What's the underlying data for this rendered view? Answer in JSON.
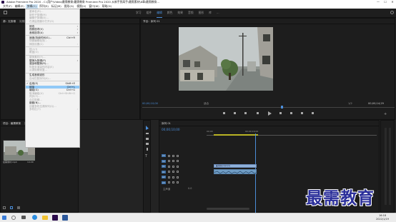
{
  "titlebar": {
    "title": "Adobe Premiere Pro 2020 - C:\\用户\\Video\\最需教育\\最需教育 Premiere Pro 2020 从新手到高手\\最需素材\\8章\\最需教育...",
    "min": "—",
    "max": "☐",
    "close": "✕"
  },
  "menubar": [
    "文件(F)",
    "编辑(E)",
    "剪辑(C)",
    "序列(S)",
    "标记(M)",
    "图形(G)",
    "视图(V)",
    "窗口(W)",
    "帮助(H)"
  ],
  "workspaces": [
    "学习",
    "组件",
    "编辑",
    "颜色",
    "效果",
    "音频",
    "图形",
    "库",
    "..."
  ],
  "active_workspace": "编辑",
  "source_tabs": [
    "源：无剪辑",
    "效果控件",
    "音频剪辑混合器：序列 01",
    "元数据"
  ],
  "program_tab": "节目：序列 01",
  "program": {
    "timecode_left": "00;00;10;00",
    "fit": "适合",
    "ratio": "1/2",
    "timecode_right": "00;00;14;29"
  },
  "menu": {
    "items": [
      {
        "label": "重命名(R)...",
        "dis": true
      },
      {
        "label": "制作子剪辑(M)",
        "dis": true
      },
      {
        "label": "编辑子剪辑(D)...",
        "dis": true
      },
      {
        "label": "在源监视器中打开(O)",
        "dis": true
      },
      {
        "label": "修改",
        "dis": false,
        "sub": true,
        "sepBefore": true
      },
      {
        "label": "视频选项(V)",
        "dis": false,
        "sub": true
      },
      {
        "label": "音频选项(A)",
        "dis": false,
        "sub": true
      },
      {
        "label": "速度/持续时间(S)...",
        "dis": false,
        "sc": "Ctrl+R",
        "sepBefore": true
      },
      {
        "label": "场景编辑检测...",
        "dis": true
      },
      {
        "label": "捕捉设置(C)",
        "dis": true,
        "sub": true
      },
      {
        "label": "插入(I)",
        "dis": true,
        "sepBefore": true
      },
      {
        "label": "覆盖(O)",
        "dis": true
      },
      {
        "label": "替换素材(F)...",
        "dis": true,
        "sepBefore": true
      },
      {
        "label": "替换为剪辑(P)",
        "dis": false,
        "sub": true
      },
      {
        "label": "渲染和替换(R)...",
        "dis": false
      },
      {
        "label": "恢复未渲染的内容(E)",
        "dis": true
      },
      {
        "label": "从源剪辑恢复...",
        "dis": true
      },
      {
        "label": "生成音频波形",
        "dis": false,
        "sepBefore": true
      },
      {
        "label": "自动匹配序列(A)...",
        "dis": true
      },
      {
        "label": "启用(E)",
        "dis": false,
        "sc": "Shift+E",
        "check": true,
        "sepBefore": true
      },
      {
        "label": "链接",
        "dis": false,
        "sc": "Ctrl+L",
        "hi": true
      },
      {
        "label": "编组(G)",
        "dis": false,
        "sc": "Ctrl+G"
      },
      {
        "label": "取消编组(U)",
        "dis": true,
        "sc": "Ctrl+Shift+G"
      },
      {
        "label": "同步(Y)...",
        "dis": true
      },
      {
        "label": "合并剪辑...",
        "dis": true
      },
      {
        "label": "嵌套(N)...",
        "dis": false
      },
      {
        "label": "创建多机位源序列(Q)...",
        "dis": true
      },
      {
        "label": "多机位(T)",
        "dis": true,
        "sub": true
      }
    ]
  },
  "project": {
    "tabs": [
      "项目：最需教育",
      "媒体浏览器",
      "库",
      "信息",
      "效果"
    ],
    "clip_name": "最需素材.mp4",
    "clip_duration": "14:29"
  },
  "timeline": {
    "tab": "序列 01",
    "timecode": "00;00;10;00",
    "ruler": [
      "00;00",
      "00;00;16;00"
    ],
    "tracks_v": [
      "V3",
      "V2",
      "V1"
    ],
    "tracks_a": [
      "A1",
      "A2",
      "A3"
    ],
    "master": "主声道",
    "master_val": "0.0",
    "v_clip": "最需素材.mp4 [V]",
    "a_clip": ""
  },
  "taskbar": {
    "time": "16:18",
    "date": "2022/1/19"
  },
  "watermark": "最需教育"
}
